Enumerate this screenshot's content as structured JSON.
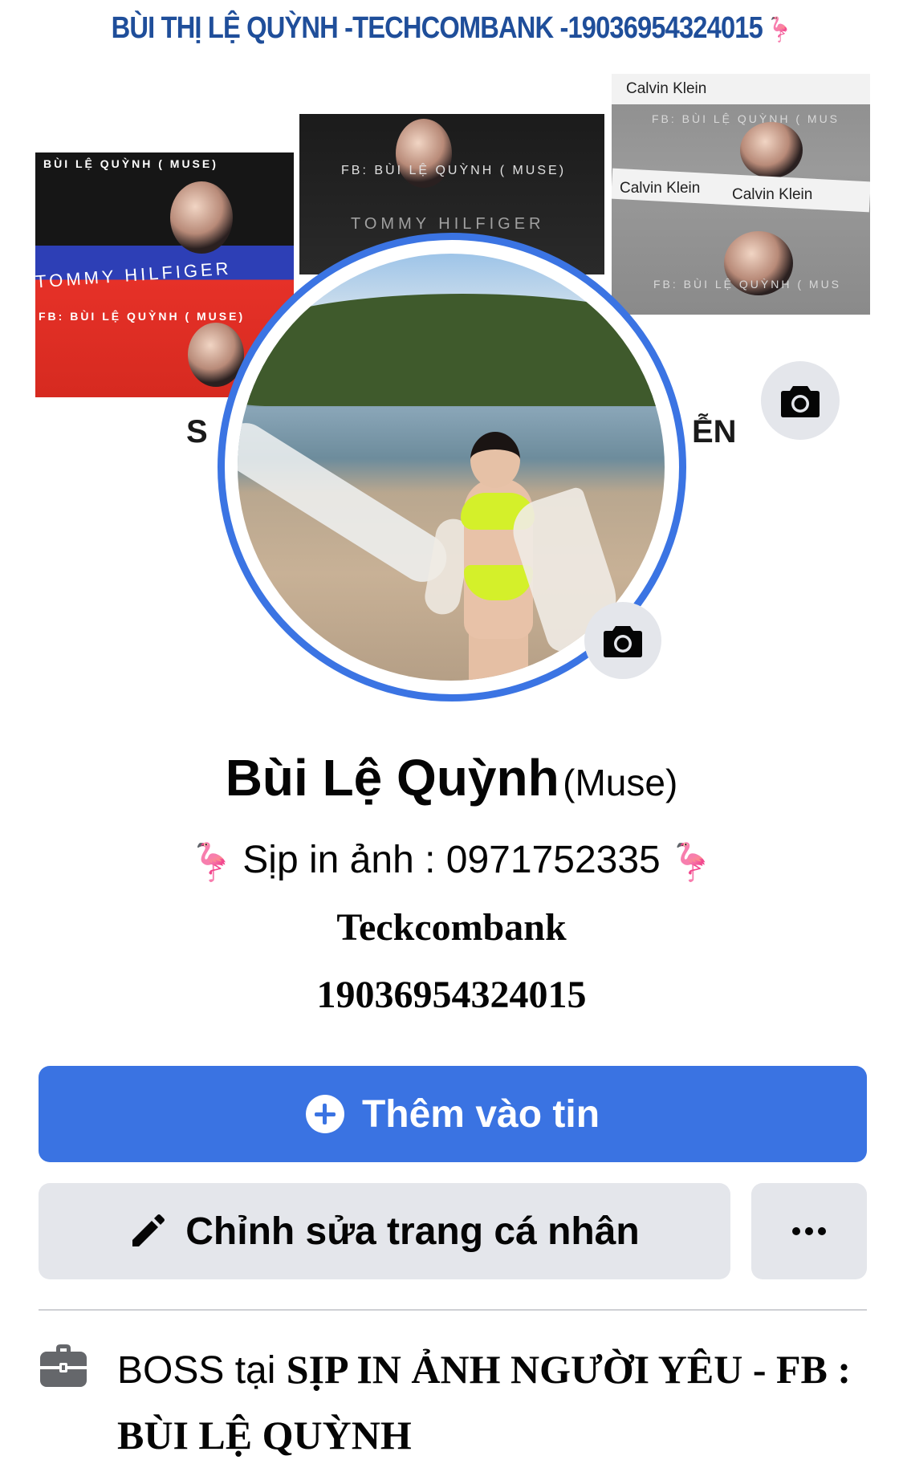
{
  "cover": {
    "banner_text": "BÙI THỊ LỆ QUỲNH -TECHCOMBANK -19036954324015",
    "left_photo": {
      "caption_top": "BÙI LỆ QUỲNH ( MUSE)",
      "brand": "TOMMY HILFIGER",
      "caption_bottom": "FB: BÙI LỆ QUỲNH ( MUSE)"
    },
    "middle_photo": {
      "caption": "FB: BÙI LỆ QUỲNH ( MUSE)",
      "brand": "TOMMY HILFIGER"
    },
    "right_photo": {
      "brand_1": "Calvin Klein",
      "brand_2": "Calvin Klein",
      "caption": "FB: BÙI LỆ QUỲNH ( MUS"
    },
    "letter_left": "S",
    "letter_right": "ỄN"
  },
  "profile": {
    "name": "Bùi Lệ Quỳnh",
    "alternate_name": "(Muse)",
    "bio_line1": "Sịp in ảnh : 0971752335",
    "bio_line2": "Teckcombank",
    "bio_line3": "19036954324015"
  },
  "buttons": {
    "add_to_story": "Thêm vào tin",
    "edit_profile": "Chỉnh sửa trang cá nhân",
    "more": "..."
  },
  "work": {
    "prefix": "BOSS tại",
    "company": "SỊP IN ẢNH NGƯỜI YÊU - FB : BÙI LỆ QUỲNH"
  },
  "icons": {
    "cover_camera": "camera-icon",
    "profile_camera": "camera-icon",
    "add_story": "plus-circle-icon",
    "edit": "pencil-icon",
    "more": "more-dots-icon",
    "work": "briefcase-icon",
    "decoration": "flamingo-icon"
  },
  "colors": {
    "primary_blue": "#3a73e2",
    "secondary_gray": "#e4e6eb",
    "profile_ring": "#3b74e3",
    "banner_text": "#1f4e9a"
  }
}
